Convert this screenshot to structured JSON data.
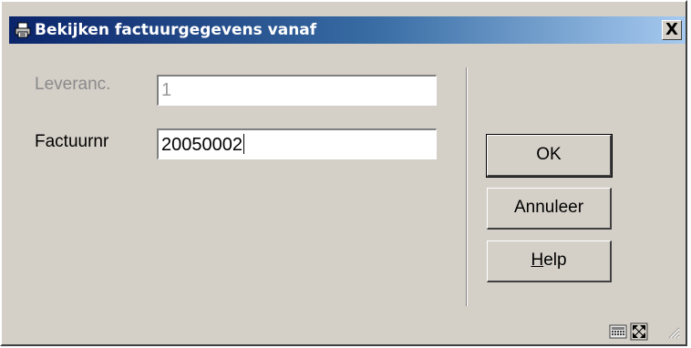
{
  "window": {
    "title": "Bekijken factuurgegevens vanaf",
    "close_label": "X",
    "title_icon": "printer-icon"
  },
  "form": {
    "supplier_label": "Leveranc.",
    "supplier_value": "1",
    "invoice_label": "Factuurnr",
    "invoice_value": "20050002"
  },
  "buttons": {
    "ok_label": "OK",
    "cancel_label": "Annuleer",
    "help_prefix": "H",
    "help_rest": "elp"
  },
  "status_icons": [
    "calculator-icon",
    "maximize-icon",
    "resize-grip-icon"
  ]
}
